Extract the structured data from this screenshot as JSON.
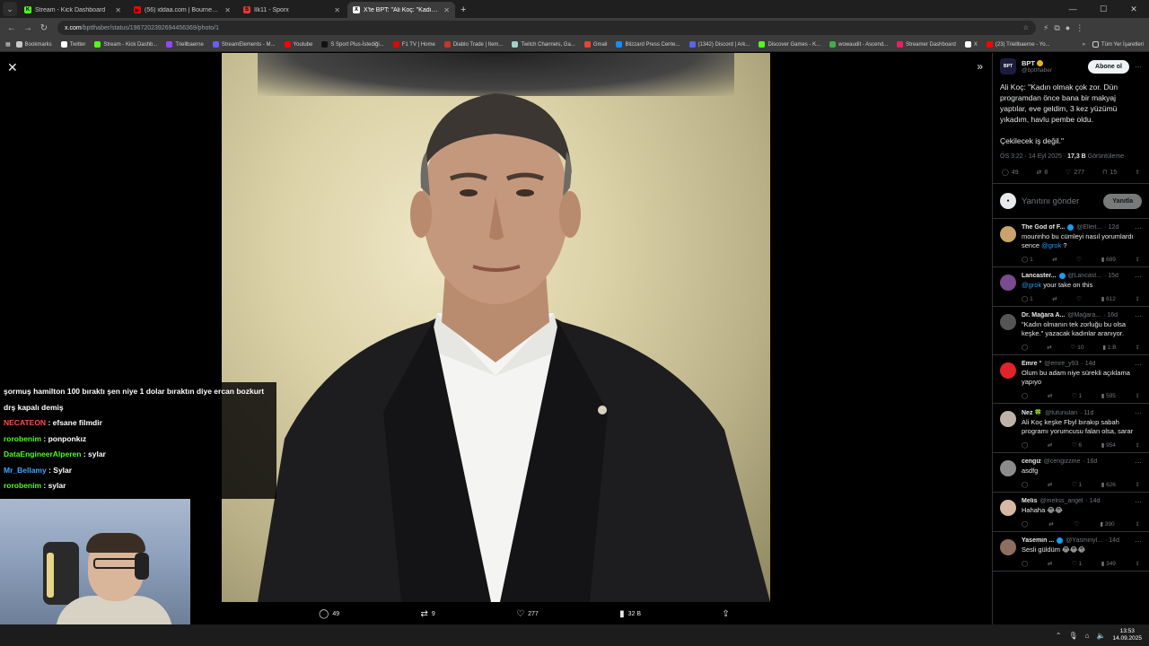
{
  "browser": {
    "tabs": [
      {
        "label": "Stream - Kick Dashboard",
        "color": "#53fc18",
        "glyph": "K"
      },
      {
        "label": "(56) iddaa.com | Bournemouth",
        "color": "#ff0000",
        "glyph": "▶"
      },
      {
        "label": "İlk11 - Sporx",
        "color": "#e53935",
        "glyph": "S"
      },
      {
        "label": "X'te BPT: \"Ali Koç: \"Kadın olmak",
        "color": "#ffffff",
        "glyph": "X",
        "active": true
      }
    ],
    "url_domain": "x.com",
    "url_path": "/bptthaber/status/1967202392694456369/photo/1",
    "bookmarks": [
      {
        "label": "Bookmarks",
        "color": "#c8c8c8"
      },
      {
        "label": "Twitter",
        "color": "#ffffff"
      },
      {
        "label": "Stream - Kick Dashb...",
        "color": "#53fc18"
      },
      {
        "label": "Triellbaerne",
        "color": "#9146ff"
      },
      {
        "label": "StreamElements - M...",
        "color": "#6b5cff"
      },
      {
        "label": "Youtube",
        "color": "#ff0000"
      },
      {
        "label": "S Sport Plus-İstediği...",
        "color": "#111111"
      },
      {
        "label": "F1 TV | Home",
        "color": "#e10600"
      },
      {
        "label": "Diablo Trade | Item...",
        "color": "#c0392b"
      },
      {
        "label": "Twitch Channels, Ga...",
        "color": "#9fd3c7"
      },
      {
        "label": "Gmail",
        "color": "#ea4335"
      },
      {
        "label": "Blizzard Press Cente...",
        "color": "#148eff"
      },
      {
        "label": "(1342) Discord | Ark...",
        "color": "#5865f2"
      },
      {
        "label": "Discover Games - K...",
        "color": "#53fc18"
      },
      {
        "label": "wowaudit - Ascend...",
        "color": "#3fae49"
      },
      {
        "label": "Streamer Dashboard",
        "color": "#e91e63"
      },
      {
        "label": "X",
        "color": "#ffffff"
      },
      {
        "label": "(23) Triellbaerne - Yo...",
        "color": "#ff0000"
      }
    ],
    "bookmarks_other": "Tüm Yer İşaretleri"
  },
  "media": {
    "stats": {
      "replies": "49",
      "reposts": "9",
      "likes": "277",
      "views": "32 B"
    }
  },
  "chat": {
    "lines": [
      {
        "user": "",
        "color": "#ffffff",
        "text": "şormuş hamilton 100 bıraktı şen niye 1 dolar bıraktın diye ercan bozkurt"
      },
      {
        "user": "",
        "color": "#ffffff",
        "text": "drş kapalı demiş"
      },
      {
        "user": "NECATEON",
        "color": "#ff4d4d",
        "text": " : efsane filmdir"
      },
      {
        "user": "rorobenim",
        "color": "#53fc18",
        "text": " : ponponkız"
      },
      {
        "user": "DataEngineerAlperen",
        "color": "#53fc18",
        "text": " : sylar"
      },
      {
        "user": "Mr_Bellamy",
        "color": "#3ea8ff",
        "text": " : Sylar"
      },
      {
        "user": "rorobenim",
        "color": "#53fc18",
        "text": " : sylar"
      }
    ]
  },
  "post": {
    "author_name": "BPT",
    "author_handle": "@bptthaber",
    "avatar_text": "BPT",
    "follow_label": "Abone ol",
    "text": "Ali Koç: \"Kadın olmak çok zor. Dün programdan önce bana bir makyaj yaptılar, eve geldim, 3 kez yüzümü yıkadım, havlu pembe oldu.\n\nÇekilecek iş değil.\"",
    "time": "ÖS 3:22 · 14 Eyl 2025 · ",
    "views_count": "17,3 B",
    "views_label": " Görüntüleme",
    "stats": {
      "replies": "49",
      "reposts": "8",
      "likes": "277",
      "bookmarks": "15"
    },
    "reply_placeholder": "Yanıtını gönder",
    "reply_button": "Yanıtla"
  },
  "replies": [
    {
      "name": "The God of F...",
      "handle": "@Elleit...",
      "time": "· 12d",
      "avatar_color": "#c9a36b",
      "verified": true,
      "text_pre": "mourinho bu cümleyi nasıl yorumlardı sence ",
      "mention": "@grok",
      "text_post": " ?",
      "stats": {
        "replies": "1",
        "reposts": "",
        "likes": "",
        "views": "689"
      }
    },
    {
      "name": "Lancaster...",
      "handle": "@Lancast...",
      "time": "· 15d",
      "avatar_color": "#7a4b8f",
      "verified": true,
      "text_pre": "",
      "mention": "@grok",
      "text_post": " your take on this",
      "stats": {
        "replies": "1",
        "reposts": "",
        "likes": "",
        "views": "612"
      }
    },
    {
      "name": "Dr. Mağara A...",
      "handle": "@Mağara...",
      "time": "· 16d",
      "avatar_color": "#555555",
      "verified": false,
      "text_pre": "\"Kadın olmanın tek zorluğu bu olsa keşke.\" yazacak kadınlar aranıyor.",
      "mention": "",
      "text_post": "",
      "stats": {
        "replies": "",
        "reposts": "",
        "likes": "10",
        "views": "1 B"
      }
    },
    {
      "name": "Emre °",
      "handle": "@emre_y93",
      "time": "· 14d",
      "avatar_color": "#e0242a",
      "verified": false,
      "text_pre": "Olum bu adam niye sürekli açıklama yapıyo",
      "mention": "",
      "text_post": "",
      "stats": {
        "replies": "",
        "reposts": "",
        "likes": "1",
        "views": "595"
      }
    },
    {
      "name": "Nez 🍀",
      "handle": "@tutunulan",
      "time": "· 11d",
      "avatar_color": "#bfb3a8",
      "verified": false,
      "text_pre": "Ali Koç keşke Fbyl bırakıp sabah programı yorumcusu falan olsa, sarar",
      "mention": "",
      "text_post": "",
      "stats": {
        "replies": "",
        "reposts": "",
        "likes": "6",
        "views": "954"
      }
    },
    {
      "name": "cengiz",
      "handle": "@cengizzme",
      "time": "· 16d",
      "avatar_color": "#8c8c8c",
      "verified": false,
      "text_pre": "asdfg",
      "mention": "",
      "text_post": "",
      "stats": {
        "replies": "",
        "reposts": "",
        "likes": "1",
        "views": "626"
      }
    },
    {
      "name": "Melis",
      "handle": "@meliss_angel",
      "time": "· 14d",
      "avatar_color": "#d6b8a5",
      "verified": false,
      "text_pre": "Hahaha 😂😂",
      "mention": "",
      "text_post": "",
      "stats": {
        "replies": "",
        "reposts": "",
        "likes": "",
        "views": "390"
      }
    },
    {
      "name": "Yasemin ...",
      "handle": "@Yasminyl...",
      "time": "· 14d",
      "avatar_color": "#8d6e63",
      "verified": true,
      "text_pre": "Sesli güldüm 😂😂😂",
      "mention": "",
      "text_post": "",
      "stats": {
        "replies": "",
        "reposts": "",
        "likes": "1",
        "views": "349"
      }
    }
  ],
  "taskbar": {
    "time": "13:53",
    "date": "14.09.2025"
  }
}
